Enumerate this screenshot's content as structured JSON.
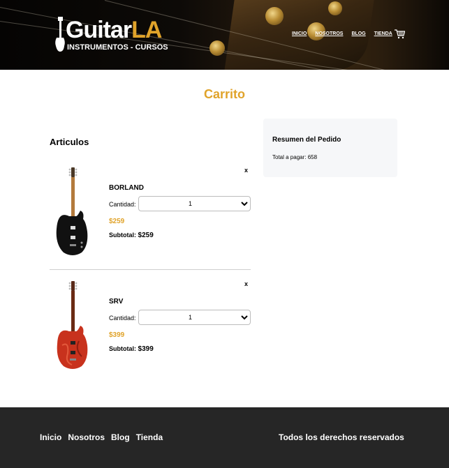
{
  "header": {
    "logo": {
      "brand_white": "Guitar",
      "brand_yellow": "LA",
      "tagline": "INSTRUMENTOS - CURSOS"
    },
    "nav": [
      "INICIO",
      "NOSOTROS",
      "BLOG",
      "TIENDA"
    ],
    "cart_icon": "shopping-cart-icon"
  },
  "main": {
    "title": "Carrito",
    "articles_title": "Articulos",
    "items": [
      {
        "name": "BORLAND",
        "quantity_label": "Cantidad:",
        "quantity": "1",
        "price": "$259",
        "subtotal_label": "Subtotal:",
        "subtotal": "$259",
        "remove": "x",
        "image_icon": "black-electric-guitar-image"
      },
      {
        "name": "SRV",
        "quantity_label": "Cantidad:",
        "quantity": "1",
        "price": "$399",
        "subtotal_label": "Subtotal:",
        "subtotal": "$399",
        "remove": "x",
        "image_icon": "red-electric-guitar-image"
      }
    ],
    "summary": {
      "title": "Resumen del Pedido",
      "total_label": "Total a pagar:",
      "total": "658"
    }
  },
  "footer": {
    "links": [
      "Inicio",
      "Nosotros",
      "Blog",
      "Tienda"
    ],
    "rights": "Todos los derechos reservados"
  },
  "colors": {
    "accent": "#e0a32a",
    "footer_bg": "#262626",
    "summary_bg": "#f6f7f9"
  }
}
